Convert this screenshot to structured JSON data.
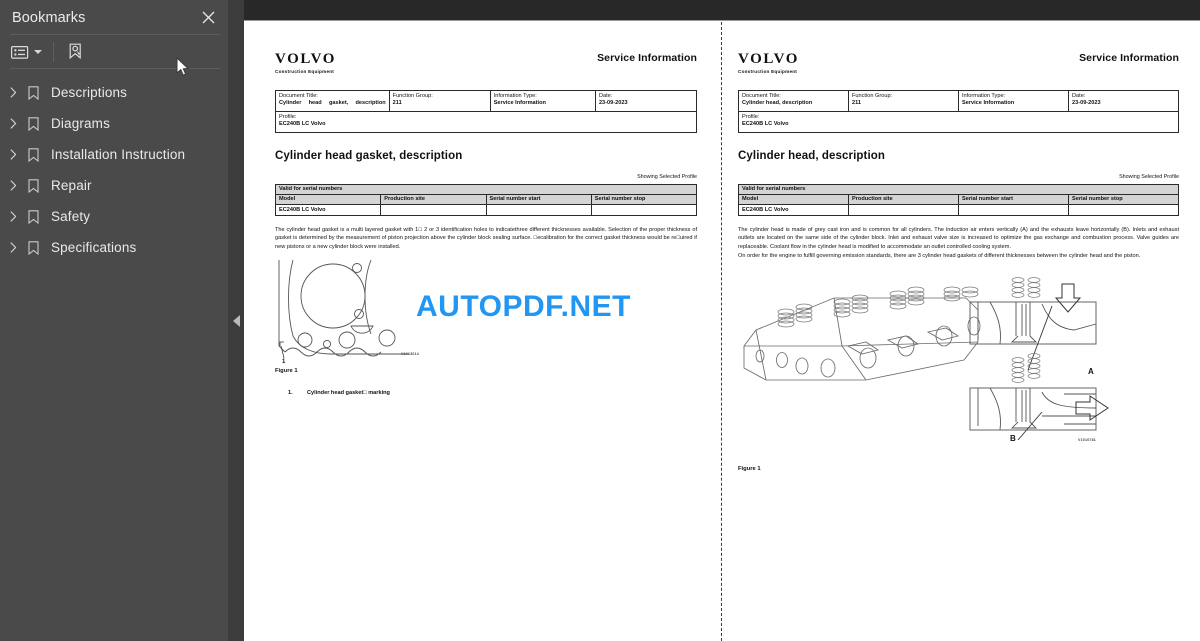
{
  "sidebar": {
    "title": "Bookmarks",
    "close_icon": "close-icon",
    "toolbar": {
      "options_icon": "list-options-icon",
      "find_bookmark_icon": "find-bookmark-icon"
    },
    "items": [
      {
        "label": "Descriptions"
      },
      {
        "label": "Diagrams"
      },
      {
        "label": "Installation Instruction"
      },
      {
        "label": "Repair"
      },
      {
        "label": "Safety"
      },
      {
        "label": "Specifications"
      }
    ]
  },
  "watermark": {
    "text": "AUTOPDF.NET",
    "color": "#2196f3"
  },
  "pages": [
    {
      "brand": "VOLVO",
      "brand_sub": "Construction Equipment",
      "service_info": "Service Information",
      "info_table": {
        "document_title_label": "Document Title:",
        "document_title_value": "Cylinder head gasket, description",
        "function_group_label": "Function Group:",
        "function_group_value": "211",
        "information_type_label": "Information Type:",
        "information_type_value": "Service Information",
        "date_label": "Date:",
        "date_value": "23-09-2023",
        "profile_label": "Profile:",
        "profile_value": "EC240B LC Volvo"
      },
      "title": "Cylinder head gasket, description",
      "showing_profile": "Showing Selected Profile",
      "serial_table": {
        "caption": "Valid for serial numbers",
        "columns": [
          "Model",
          "Production site",
          "Serial number start",
          "Serial number stop"
        ],
        "rows": [
          [
            "EC240B LC Volvo",
            "",
            "",
            ""
          ]
        ]
      },
      "paragraphs": [
        "The cylinder head gasket is a multi layered gasket with 1□ 2 or 3 identification holes to indicatethree different thicknesses available. Selection of the proper thickness of gasket is determined by the measurement of piston projection above the cylinder block sealing surface. □ecalibration for the correct gasket thickness would be re□uired if new pistons or a new cylinder block were installed."
      ],
      "figure": {
        "caption": "Figure 1",
        "code": "V1013014",
        "callout": "1",
        "legend": [
          {
            "num": "1.",
            "text": "Cylinder head gasket□ marking"
          }
        ]
      }
    },
    {
      "brand": "VOLVO",
      "brand_sub": "Construction Equipment",
      "service_info": "Service Information",
      "info_table": {
        "document_title_label": "Document Title:",
        "document_title_value": "Cylinder head, description",
        "function_group_label": "Function Group:",
        "function_group_value": "211",
        "information_type_label": "Information Type:",
        "information_type_value": "Service Information",
        "date_label": "Date:",
        "date_value": "23-09-2023",
        "profile_label": "Profile:",
        "profile_value": "EC240B LC Volvo"
      },
      "title": "Cylinder head, description",
      "showing_profile": "Showing Selected Profile",
      "serial_table": {
        "caption": "Valid for serial numbers",
        "columns": [
          "Model",
          "Production site",
          "Serial number start",
          "Serial number stop"
        ],
        "rows": [
          [
            "EC240B LC Volvo",
            "",
            "",
            ""
          ]
        ]
      },
      "paragraphs": [
        "The cylinder head is made of grey cast iron and is common for all cylinders. The induction air enters vertically (A) and the exhausts leave horizontally (B). Inlets and exhaust outlets are located on the same side of the cylinder block. Inlet and exhaust valve size is increased to optimize the gas exchange and combustion process. Valve guides are replaceable. Coolant flow in the cylinder head is modified to accommodate an outlet controlled cooling system.",
        "On order for the engine to fulfill governing emission standards, there are 3 cylinder head gaskets of different thicknesses between the cylinder head and the piston."
      ],
      "figure": {
        "caption": "Figure 1",
        "code": "V1010781",
        "letters": [
          "A",
          "B"
        ]
      }
    }
  ]
}
